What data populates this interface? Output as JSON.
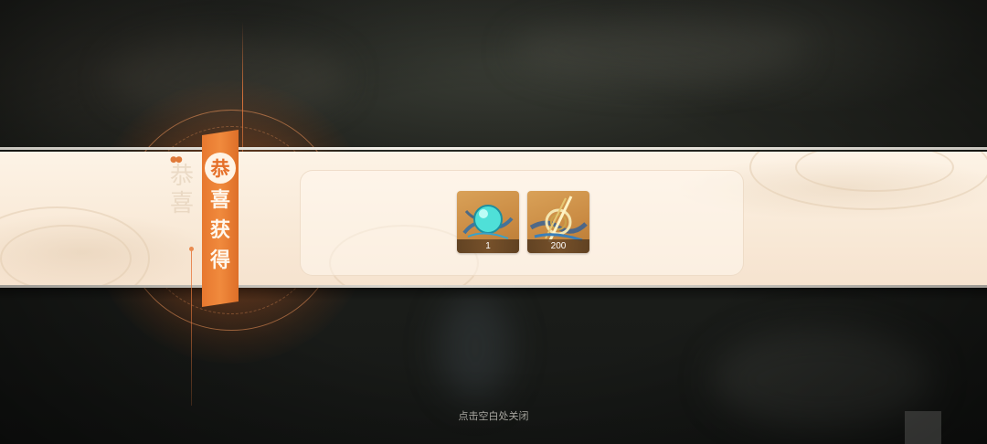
{
  "reward_popup": {
    "tag_chars": [
      "恭",
      "喜",
      "获",
      "得"
    ],
    "ghost_chars": "恭喜",
    "items": [
      {
        "icon": "cyan-orb-icon",
        "quantity": "1"
      },
      {
        "icon": "gold-sword-icon",
        "quantity": "200"
      }
    ],
    "close_hint": "点击空白处关闭"
  },
  "colors": {
    "accent_orange": "#ee8538",
    "banner_cream": "#fbeedd",
    "item_bg": "#cd8f46"
  }
}
